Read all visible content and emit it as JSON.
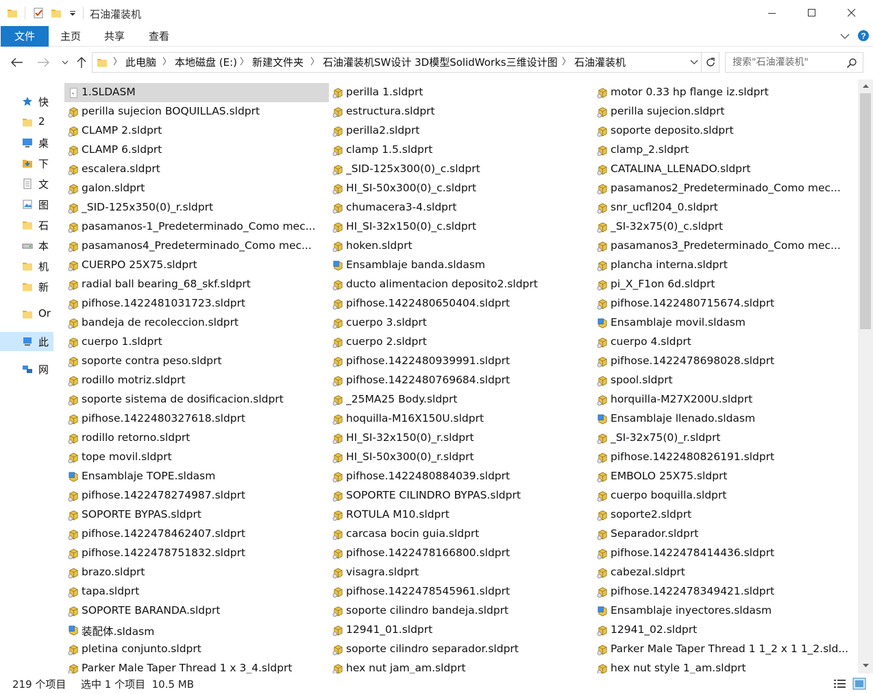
{
  "window": {
    "title": "石油灌装机",
    "minimize_icon": "minimize-icon",
    "maximize_icon": "maximize-icon",
    "close_icon": "close-icon"
  },
  "ribbon": {
    "tabs": [
      "文件",
      "主页",
      "共享",
      "查看"
    ],
    "expand_icon": "chevron-down-icon",
    "help_icon": "help-icon"
  },
  "address": {
    "crumbs": [
      "此电脑",
      "本地磁盘 (E:)",
      "新建文件夹",
      "石油灌装机SW设计 3D模型SolidWorks三维设计图",
      "石油灌装机"
    ]
  },
  "search": {
    "placeholder": "搜索\"石油灌装机\""
  },
  "nav_pane": {
    "items": [
      {
        "label": "快",
        "icon": "star-icon"
      },
      {
        "label": "2",
        "icon": "folder-icon"
      },
      {
        "label": "桌",
        "icon": "desktop-icon"
      },
      {
        "label": "下",
        "icon": "download-icon"
      },
      {
        "label": "文",
        "icon": "document-icon"
      },
      {
        "label": "图",
        "icon": "picture-icon"
      },
      {
        "label": "石",
        "icon": "folder-icon"
      },
      {
        "label": "本",
        "icon": "drive-icon"
      },
      {
        "label": "机",
        "icon": "folder-icon"
      },
      {
        "label": "新",
        "icon": "folder-icon"
      },
      {
        "label": "Or",
        "icon": "folder-icon"
      },
      {
        "label": "此",
        "icon": "computer-icon"
      },
      {
        "label": "网",
        "icon": "network-icon"
      }
    ]
  },
  "files": {
    "col1": [
      {
        "name": "1.SLDASM",
        "type": "generic"
      },
      {
        "name": "perilla sujecion BOQUILLAS.sldprt",
        "type": "part"
      },
      {
        "name": "CLAMP 2.sldprt",
        "type": "part"
      },
      {
        "name": "CLAMP 6.sldprt",
        "type": "part"
      },
      {
        "name": "escalera.sldprt",
        "type": "part"
      },
      {
        "name": "galon.sldprt",
        "type": "part"
      },
      {
        "name": "_SID-125x350(0)_r.sldprt",
        "type": "part"
      },
      {
        "name": "pasamanos-1_Predeterminado_Como mec...",
        "type": "part"
      },
      {
        "name": "pasamanos4_Predeterminado_Como mec...",
        "type": "part"
      },
      {
        "name": "CUERPO 25X75.sldprt",
        "type": "part"
      },
      {
        "name": "radial ball bearing_68_skf.sldprt",
        "type": "part"
      },
      {
        "name": "pifhose.1422481031723.sldprt",
        "type": "part"
      },
      {
        "name": "bandeja de recoleccion.sldprt",
        "type": "part"
      },
      {
        "name": "cuerpo 1.sldprt",
        "type": "part"
      },
      {
        "name": "soporte contra peso.sldprt",
        "type": "part"
      },
      {
        "name": "rodillo motriz.sldprt",
        "type": "part"
      },
      {
        "name": "soporte sistema de dosificacion.sldprt",
        "type": "part"
      },
      {
        "name": "pifhose.1422480327618.sldprt",
        "type": "part"
      },
      {
        "name": "rodillo retorno.sldprt",
        "type": "part"
      },
      {
        "name": "tope movil.sldprt",
        "type": "part"
      },
      {
        "name": "Ensamblaje TOPE.sldasm",
        "type": "assembly"
      },
      {
        "name": "pifhose.1422478274987.sldprt",
        "type": "part"
      },
      {
        "name": "SOPORTE BYPAS.sldprt",
        "type": "part"
      },
      {
        "name": "pifhose.1422478462407.sldprt",
        "type": "part"
      },
      {
        "name": "pifhose.1422478751832.sldprt",
        "type": "part"
      },
      {
        "name": "brazo.sldprt",
        "type": "part"
      },
      {
        "name": "tapa.sldprt",
        "type": "part"
      },
      {
        "name": "SOPORTE BARANDA.sldprt",
        "type": "part"
      },
      {
        "name": "装配体.sldasm",
        "type": "assembly"
      },
      {
        "name": "pletina conjunto.sldprt",
        "type": "part"
      },
      {
        "name": "Parker Male Taper Thread 1 x 3_4.sldprt",
        "type": "part"
      }
    ],
    "col2": [
      {
        "name": "perilla 1.sldprt",
        "type": "part"
      },
      {
        "name": "estructura.sldprt",
        "type": "part"
      },
      {
        "name": "perilla2.sldprt",
        "type": "part"
      },
      {
        "name": "clamp 1.5.sldprt",
        "type": "part"
      },
      {
        "name": "_SID-125x300(0)_c.sldprt",
        "type": "part"
      },
      {
        "name": "HI_SI-50x300(0)_c.sldprt",
        "type": "part"
      },
      {
        "name": "chumacera3-4.sldprt",
        "type": "part"
      },
      {
        "name": "HI_SI-32x150(0)_c.sldprt",
        "type": "part"
      },
      {
        "name": "hoken.sldprt",
        "type": "part"
      },
      {
        "name": "Ensamblaje banda.sldasm",
        "type": "assembly"
      },
      {
        "name": "ducto alimentacion deposito2.sldprt",
        "type": "part"
      },
      {
        "name": "pifhose.1422480650404.sldprt",
        "type": "part"
      },
      {
        "name": "cuerpo 3.sldprt",
        "type": "part"
      },
      {
        "name": "cuerpo 2.sldprt",
        "type": "part"
      },
      {
        "name": "pifhose.1422480939991.sldprt",
        "type": "part"
      },
      {
        "name": "pifhose.1422480769684.sldprt",
        "type": "part"
      },
      {
        "name": "_25MA25 Body.sldprt",
        "type": "part"
      },
      {
        "name": "hoquilla-M16X150U.sldprt",
        "type": "part"
      },
      {
        "name": "HI_SI-32x150(0)_r.sldprt",
        "type": "part"
      },
      {
        "name": "HI_SI-50x300(0)_r.sldprt",
        "type": "part"
      },
      {
        "name": "pifhose.1422480884039.sldprt",
        "type": "part"
      },
      {
        "name": "SOPORTE CILINDRO BYPAS.sldprt",
        "type": "part"
      },
      {
        "name": "ROTULA M10.sldprt",
        "type": "part"
      },
      {
        "name": "carcasa bocin guia.sldprt",
        "type": "part"
      },
      {
        "name": "pifhose.1422478166800.sldprt",
        "type": "part"
      },
      {
        "name": "visagra.sldprt",
        "type": "part"
      },
      {
        "name": "pifhose.1422478545961.sldprt",
        "type": "part"
      },
      {
        "name": "soporte cilindro bandeja.sldprt",
        "type": "part"
      },
      {
        "name": "12941_01.sldprt",
        "type": "part"
      },
      {
        "name": "soporte cilindro separador.sldprt",
        "type": "part"
      },
      {
        "name": "hex nut jam_am.sldprt",
        "type": "part"
      }
    ],
    "col3": [
      {
        "name": "motor 0.33 hp flange iz.sldprt",
        "type": "part"
      },
      {
        "name": "perilla sujecion.sldprt",
        "type": "part"
      },
      {
        "name": "soporte deposito.sldprt",
        "type": "part"
      },
      {
        "name": "clamp_2.sldprt",
        "type": "part"
      },
      {
        "name": "CATALINA_LLENADO.sldprt",
        "type": "part"
      },
      {
        "name": "pasamanos2_Predeterminado_Como mec...",
        "type": "part"
      },
      {
        "name": "snr_ucfl204_0.sldprt",
        "type": "part"
      },
      {
        "name": "_SI-32x75(0)_c.sldprt",
        "type": "part"
      },
      {
        "name": "pasamanos3_Predeterminado_Como mec...",
        "type": "part"
      },
      {
        "name": "plancha interna.sldprt",
        "type": "part"
      },
      {
        "name": "pi_X_F1on 6d.sldprt",
        "type": "part"
      },
      {
        "name": "pifhose.1422480715674.sldprt",
        "type": "part"
      },
      {
        "name": "Ensamblaje movil.sldasm",
        "type": "assembly"
      },
      {
        "name": "cuerpo 4.sldprt",
        "type": "part"
      },
      {
        "name": "pifhose.1422478698028.sldprt",
        "type": "part"
      },
      {
        "name": "spool.sldprt",
        "type": "part"
      },
      {
        "name": "horquilla-M27X200U.sldprt",
        "type": "part"
      },
      {
        "name": "Ensamblaje llenado.sldasm",
        "type": "assembly"
      },
      {
        "name": "_SI-32x75(0)_r.sldprt",
        "type": "part"
      },
      {
        "name": "pifhose.1422480826191.sldprt",
        "type": "part"
      },
      {
        "name": "EMBOLO 25X75.sldprt",
        "type": "part"
      },
      {
        "name": "cuerpo boquilla.sldprt",
        "type": "part"
      },
      {
        "name": "soporte2.sldprt",
        "type": "part"
      },
      {
        "name": "Separador.sldprt",
        "type": "part"
      },
      {
        "name": "pifhose.1422478414436.sldprt",
        "type": "part"
      },
      {
        "name": "cabezal.sldprt",
        "type": "part"
      },
      {
        "name": "pifhose.1422478349421.sldprt",
        "type": "part"
      },
      {
        "name": "Ensamblaje inyectores.sldasm",
        "type": "assembly"
      },
      {
        "name": "12941_02.sldprt",
        "type": "part"
      },
      {
        "name": "Parker Male Taper Thread 1 1_2 x 1 1_2.sld...",
        "type": "part"
      },
      {
        "name": "hex nut style 1_am.sldprt",
        "type": "part"
      }
    ]
  },
  "selected_file": "1.SLDASM",
  "status": {
    "item_count": "219 个项目",
    "selection": "选中 1 个项目  10.5 MB"
  },
  "colors": {
    "accent": "#1979ca",
    "selected_bg": "#d9d9d9",
    "nav_selected_bg": "#cce8ff"
  }
}
